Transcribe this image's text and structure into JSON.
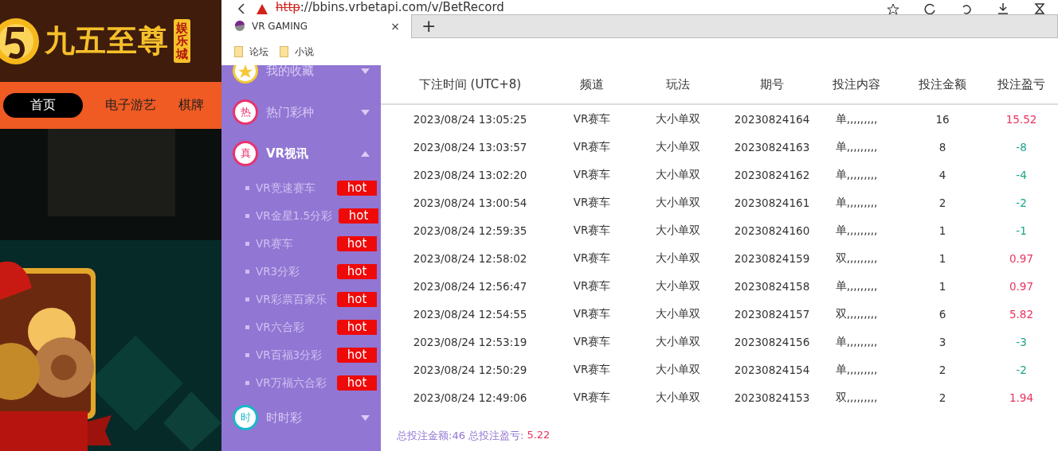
{
  "site": {
    "logo": {
      "name": "九五至尊",
      "tag": "娱乐城"
    },
    "nav": [
      {
        "label": "首页",
        "selected": true
      },
      {
        "label": "电子游艺",
        "selected": false
      },
      {
        "label": "棋牌",
        "selected": false
      }
    ]
  },
  "browser": {
    "address": {
      "scheme": "http",
      "rest": "://bbins.vrbetapi.com/v/BetRecord"
    },
    "tabs": [
      {
        "title": "VR GAMING",
        "selected": true,
        "close": "×"
      }
    ],
    "new_tab": "+",
    "bookmarks": [
      "论坛",
      "小说"
    ]
  },
  "sidebar": {
    "groups": [
      {
        "label": "我的收藏",
        "expanded": false,
        "kind": "star",
        "color": "#f5c93a"
      },
      {
        "badge": "热",
        "label": "热门彩种",
        "expanded": false,
        "kind": "text",
        "color": "#e8336d"
      },
      {
        "badge": "真",
        "label": "VR视讯",
        "expanded": true,
        "kind": "text",
        "color": "#e8336d",
        "children": [
          {
            "label": "VR竞速赛车",
            "tag": "hot"
          },
          {
            "label": "VR金星1.5分彩",
            "tag": "hot"
          },
          {
            "label": "VR赛车",
            "tag": "hot"
          },
          {
            "label": "VR3分彩",
            "tag": "hot"
          },
          {
            "label": "VR彩票百家乐",
            "tag": "hot"
          },
          {
            "label": "VR六合彩",
            "tag": "hot"
          },
          {
            "label": "VR百福3分彩",
            "tag": "hot"
          },
          {
            "label": "VR万福六合彩",
            "tag": "hot"
          }
        ]
      },
      {
        "badge": "时",
        "label": "时时彩",
        "expanded": false,
        "kind": "text",
        "color": "#19b8c9"
      }
    ]
  },
  "table": {
    "columns": [
      "下注时间 (UTC+8)",
      "频道",
      "玩法",
      "期号",
      "投注内容",
      "投注金额",
      "投注盈亏"
    ],
    "rows": [
      {
        "time": "2023/08/24 13:05:25",
        "channel": "VR赛车",
        "play": "大小单双",
        "issue": "20230824164",
        "content": "单,,,,,,,,,",
        "amount": "16",
        "profit": "15.52",
        "kind": "win"
      },
      {
        "time": "2023/08/24 13:03:57",
        "channel": "VR赛车",
        "play": "大小单双",
        "issue": "20230824163",
        "content": "单,,,,,,,,,",
        "amount": "8",
        "profit": "-8",
        "kind": "loss"
      },
      {
        "time": "2023/08/24 13:02:20",
        "channel": "VR赛车",
        "play": "大小单双",
        "issue": "20230824162",
        "content": "单,,,,,,,,,",
        "amount": "4",
        "profit": "-4",
        "kind": "loss"
      },
      {
        "time": "2023/08/24 13:00:54",
        "channel": "VR赛车",
        "play": "大小单双",
        "issue": "20230824161",
        "content": "单,,,,,,,,,",
        "amount": "2",
        "profit": "-2",
        "kind": "loss"
      },
      {
        "time": "2023/08/24 12:59:35",
        "channel": "VR赛车",
        "play": "大小单双",
        "issue": "20230824160",
        "content": "单,,,,,,,,,",
        "amount": "1",
        "profit": "-1",
        "kind": "loss"
      },
      {
        "time": "2023/08/24 12:58:02",
        "channel": "VR赛车",
        "play": "大小单双",
        "issue": "20230824159",
        "content": "双,,,,,,,,,",
        "amount": "1",
        "profit": "0.97",
        "kind": "win"
      },
      {
        "time": "2023/08/24 12:56:47",
        "channel": "VR赛车",
        "play": "大小单双",
        "issue": "20230824158",
        "content": "单,,,,,,,,,",
        "amount": "1",
        "profit": "0.97",
        "kind": "win"
      },
      {
        "time": "2023/08/24 12:54:55",
        "channel": "VR赛车",
        "play": "大小单双",
        "issue": "20230824157",
        "content": "双,,,,,,,,,",
        "amount": "6",
        "profit": "5.82",
        "kind": "win"
      },
      {
        "time": "2023/08/24 12:53:19",
        "channel": "VR赛车",
        "play": "大小单双",
        "issue": "20230824156",
        "content": "单,,,,,,,,,",
        "amount": "3",
        "profit": "-3",
        "kind": "loss"
      },
      {
        "time": "2023/08/24 12:50:29",
        "channel": "VR赛车",
        "play": "大小单双",
        "issue": "20230824154",
        "content": "单,,,,,,,,,",
        "amount": "2",
        "profit": "-2",
        "kind": "loss"
      },
      {
        "time": "2023/08/24 12:49:06",
        "channel": "VR赛车",
        "play": "大小单双",
        "issue": "20230824153",
        "content": "双,,,,,,,,,",
        "amount": "2",
        "profit": "1.94",
        "kind": "win"
      }
    ]
  },
  "summary": {
    "label": "总投注金额:46 总投注盈亏:",
    "profit": "5.22",
    "kind": "win"
  }
}
